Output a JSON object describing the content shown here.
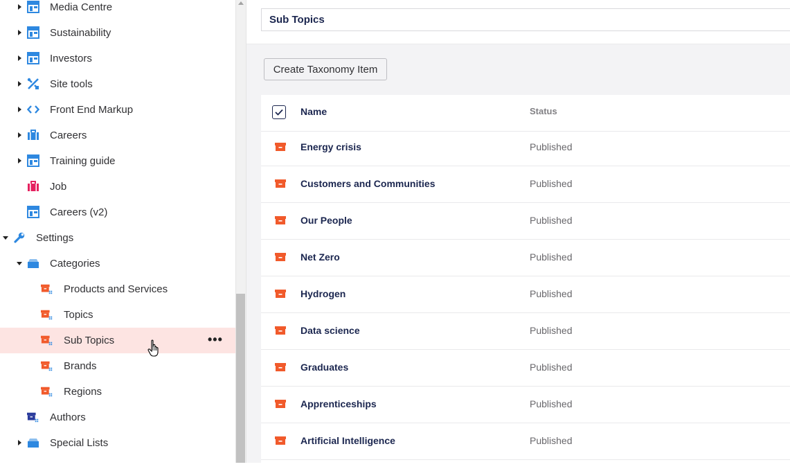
{
  "sidebar": {
    "items": [
      {
        "label": "Media Centre",
        "icon": "document-type-icon",
        "caret": "right",
        "indent": 0
      },
      {
        "label": "Sustainability",
        "icon": "document-type-icon",
        "caret": "right",
        "indent": 0
      },
      {
        "label": "Investors",
        "icon": "document-type-icon",
        "caret": "right",
        "indent": 0
      },
      {
        "label": "Site tools",
        "icon": "tools-icon",
        "caret": "right",
        "indent": 0
      },
      {
        "label": "Front End Markup",
        "icon": "code-icon",
        "caret": "right",
        "indent": 0
      },
      {
        "label": "Careers",
        "icon": "briefcase-icon",
        "caret": "right",
        "indent": 0
      },
      {
        "label": "Training guide",
        "icon": "document-type-icon",
        "caret": "right",
        "indent": 0
      },
      {
        "label": "Job",
        "icon": "briefcase-pink-icon",
        "caret": "",
        "indent": 0
      },
      {
        "label": "Careers (v2)",
        "icon": "document-type-icon",
        "caret": "",
        "indent": 0
      },
      {
        "label": "Settings",
        "icon": "wrench-icon",
        "caret": "down",
        "indent": -1
      },
      {
        "label": "Categories",
        "icon": "folder-stack-icon",
        "caret": "down",
        "indent": 0
      },
      {
        "label": "Products and Services",
        "icon": "taxonomy-icon",
        "caret": "",
        "indent": 1
      },
      {
        "label": "Topics",
        "icon": "taxonomy-icon",
        "caret": "",
        "indent": 1
      },
      {
        "label": "Sub Topics",
        "icon": "taxonomy-icon",
        "caret": "",
        "indent": 1,
        "active": true
      },
      {
        "label": "Brands",
        "icon": "taxonomy-icon",
        "caret": "",
        "indent": 1
      },
      {
        "label": "Regions",
        "icon": "taxonomy-icon",
        "caret": "",
        "indent": 1
      },
      {
        "label": "Authors",
        "icon": "taxonomy-blue-icon",
        "caret": "",
        "indent": 0
      },
      {
        "label": "Special Lists",
        "icon": "folder-stack-icon",
        "caret": "right",
        "indent": 0
      }
    ],
    "more_label": "•••"
  },
  "header": {
    "name_value": "Sub Topics"
  },
  "toolbar": {
    "create_label": "Create Taxonomy Item"
  },
  "table": {
    "columns": {
      "name": "Name",
      "status": "Status"
    },
    "rows": [
      {
        "name": "Energy crisis",
        "status": "Published"
      },
      {
        "name": "Customers and Communities",
        "status": "Published"
      },
      {
        "name": "Our People",
        "status": "Published"
      },
      {
        "name": "Net Zero",
        "status": "Published"
      },
      {
        "name": "Hydrogen",
        "status": "Published"
      },
      {
        "name": "Data science",
        "status": "Published"
      },
      {
        "name": "Graduates",
        "status": "Published"
      },
      {
        "name": "Apprenticeships",
        "status": "Published"
      },
      {
        "name": "Artificial Intelligence",
        "status": "Published"
      }
    ]
  },
  "colors": {
    "accent_blue": "#2e88e0",
    "taxonomy_orange": "#f15a2b",
    "active_row": "#fde4e2",
    "navy_text": "#1b264f"
  }
}
